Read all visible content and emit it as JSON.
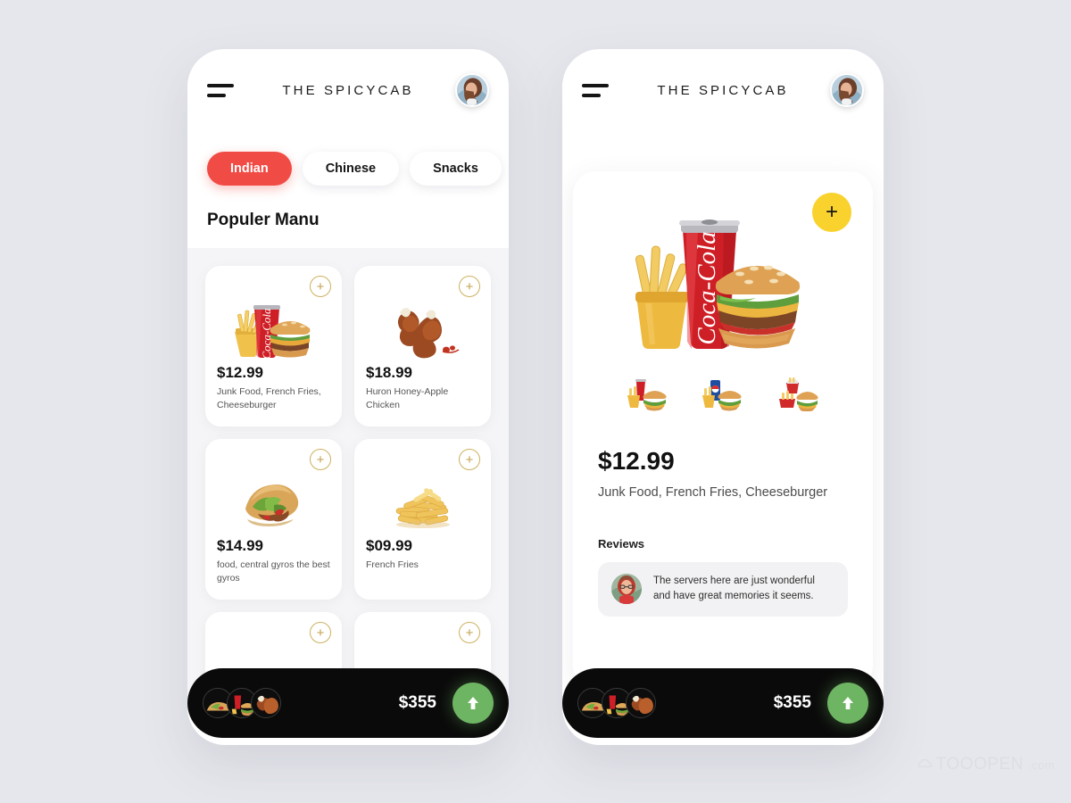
{
  "page": {
    "background_color": "#E6E7EC",
    "watermark": "TOOOPEN",
    "watermark_suffix": ".com"
  },
  "colors": {
    "accent_red": "#F14B45",
    "accent_yellow": "#FAD22D",
    "accent_green": "#6EB563",
    "cart_black": "#0A0A0A",
    "plus_gold": "#C2A14C"
  },
  "header": {
    "title": "THE SPICYCAB",
    "menu_icon": "hamburger-icon",
    "avatar_icon": "user-avatar"
  },
  "list_screen": {
    "tabs": [
      {
        "label": "Indian",
        "active": true
      },
      {
        "label": "Chinese",
        "active": false
      },
      {
        "label": "Snacks",
        "active": false
      }
    ],
    "section_title": "Populer Manu",
    "items": [
      {
        "price": "$12.99",
        "description": "Junk Food, French Fries, Cheeseburger",
        "image": "cola-burger-fries",
        "add_icon": "plus-icon"
      },
      {
        "price": "$18.99",
        "description": "Huron Honey-Apple Chicken",
        "image": "fried-chicken",
        "add_icon": "plus-icon"
      },
      {
        "price": "$14.99",
        "description": "food, central gyros the best gyros",
        "image": "gyros-sandwich",
        "add_icon": "plus-icon"
      },
      {
        "price": "$09.99",
        "description": "French Fries",
        "image": "french-fries",
        "add_icon": "plus-icon"
      },
      {
        "price": "",
        "description": "",
        "image": "fries-partial",
        "add_icon": "plus-icon"
      },
      {
        "price": "",
        "description": "",
        "image": "chicken-partial",
        "add_icon": "plus-icon"
      }
    ]
  },
  "detail_screen": {
    "add_button_label": "+",
    "add_button_icon": "plus-icon",
    "hero_image": "cola-burger-fries-large",
    "thumbnails": [
      {
        "image": "cola-combo"
      },
      {
        "image": "pepsi-combo"
      },
      {
        "image": "redbox-combo"
      }
    ],
    "price": "$12.99",
    "description": "Junk Food, French Fries, Cheeseburger",
    "reviews_label": "Reviews",
    "reviews": [
      {
        "avatar": "reviewer-avatar",
        "text": "The servers here are just wonderful and have great memories it seems."
      }
    ]
  },
  "cart": {
    "total": "$355",
    "thumbs": [
      {
        "image": "gyros-thumb"
      },
      {
        "image": "cola-burger-thumb"
      },
      {
        "image": "chicken-thumb"
      }
    ],
    "go_icon": "arrow-up-icon"
  }
}
